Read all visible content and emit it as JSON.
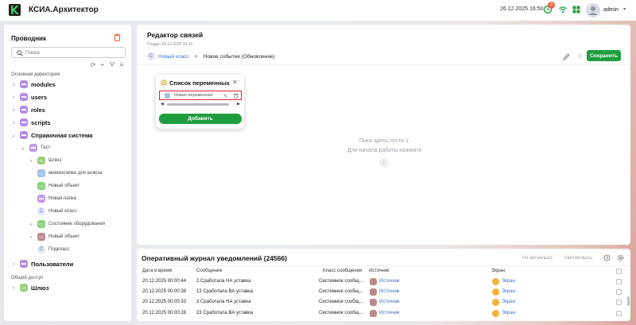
{
  "header": {
    "app_title": "КСИА.Архитектор",
    "datetime": "26.12.2025 16:50",
    "notification_count": "3",
    "user_name": "admin",
    "icons": [
      "clock-icon",
      "wifi-icon",
      "grid-icon",
      "user-avatar-icon",
      "chevron-down-icon"
    ]
  },
  "sidebar": {
    "title": "Проводник",
    "search_placeholder": "Поиск",
    "section_main": "Основная директория",
    "section_shared": "Общий доступ",
    "items": [
      {
        "label": "modules"
      },
      {
        "label": "users"
      },
      {
        "label": "roles"
      },
      {
        "label": "scripts"
      },
      {
        "label": "Справочная система"
      },
      {
        "label": "Тест"
      },
      {
        "label": "Шлюз"
      },
      {
        "label": "мнемосхема для шлюза"
      },
      {
        "label": "Новый объект"
      },
      {
        "label": "Новая папка"
      },
      {
        "label": "Новый класс"
      },
      {
        "label": "Состояние оборудования"
      },
      {
        "label": "Новый объект"
      },
      {
        "label": "Подкласс"
      },
      {
        "label": "Пользователи"
      }
    ],
    "shared_items": [
      {
        "label": "Шлюз"
      }
    ]
  },
  "editor": {
    "title": "Редактор связей",
    "created": "Создан 26.12.2025 15:10",
    "breadcrumb_class": "Новый класс",
    "breadcrumb_event": "Новое событие (Обновление)",
    "save_label": "Сохранить",
    "empty_text_1": "Пока здесь пусто :(",
    "empty_text_2": "Для начала работы нажмите"
  },
  "variables_popup": {
    "title": "Список переменных",
    "items": [
      {
        "label": "Новая переменная"
      }
    ],
    "add_label": "Добавить"
  },
  "journal": {
    "title": "Оперативный журнал уведомлений (24566)",
    "action_irrelevant": "Не актуально",
    "action_quote": "Квитировать",
    "columns": [
      "Дата и время",
      "Сообщение",
      "Класс сообщения",
      "Источник",
      "Экран"
    ],
    "rows": [
      {
        "datetime": "20.12.2025 00:00:44",
        "message": "2 Сработала НА уставка",
        "class": "Системное сообщ...",
        "source": "Источник",
        "screen": "Экран"
      },
      {
        "datetime": "20.12.2025 00:00:38",
        "message": "13 Сработала ВА уставка",
        "class": "Системное сообщ...",
        "source": "Источник",
        "screen": "Экран"
      },
      {
        "datetime": "20.12.2025 00:00:33",
        "message": "3 Сработала НА уставка",
        "class": "Системное сообщ...",
        "source": "Источник",
        "screen": "Экран"
      },
      {
        "datetime": "20.12.2025 00:00:28",
        "message": "23 Сработала ВА уставка",
        "class": "Системное сообщ...",
        "source": "Источник",
        "screen": "Экран"
      }
    ]
  },
  "colors": {
    "accent_green": "#1e9e3e",
    "folder_purple": "#b58be0",
    "link_blue": "#3b6fc7",
    "highlight_red": "#d8262c",
    "badge_orange": "#e8643c"
  }
}
